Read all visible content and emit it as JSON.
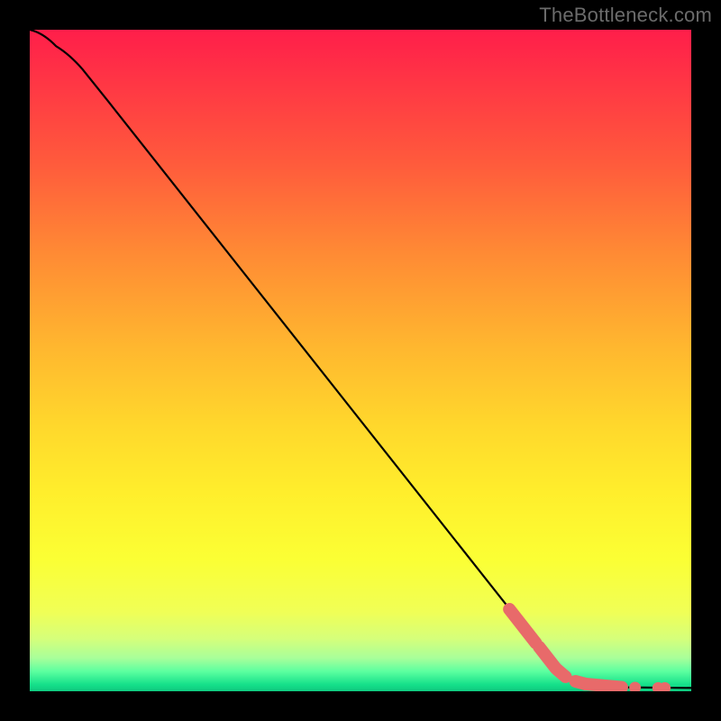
{
  "watermark": "TheBottleneck.com",
  "chart_data": {
    "type": "line",
    "title": "",
    "xlabel": "",
    "ylabel": "",
    "xlim": [
      0,
      100
    ],
    "ylim": [
      0,
      100
    ],
    "curve": [
      {
        "x": 0,
        "y": 100
      },
      {
        "x": 4,
        "y": 97.5
      },
      {
        "x": 8,
        "y": 94
      },
      {
        "x": 12,
        "y": 89
      },
      {
        "x": 80,
        "y": 3
      },
      {
        "x": 84,
        "y": 1.2
      },
      {
        "x": 90,
        "y": 0.6
      },
      {
        "x": 100,
        "y": 0.5
      }
    ],
    "highlight_runs": [
      {
        "xa": 72.5,
        "ya": 12.4,
        "xb": 76.5,
        "yb": 7.3
      },
      {
        "xa": 77.0,
        "ya": 6.7,
        "xb": 79.5,
        "yb": 3.5
      },
      {
        "xa": 79.7,
        "ya": 3.3,
        "xb": 81.0,
        "yb": 2.2
      },
      {
        "xa": 82.5,
        "ya": 1.5,
        "xb": 84.0,
        "yb": 1.1
      },
      {
        "xa": 84.0,
        "ya": 1.1,
        "xb": 89.5,
        "yb": 0.6
      }
    ],
    "highlight_dots": [
      {
        "x": 91.5,
        "y": 0.55
      },
      {
        "x": 95.0,
        "y": 0.5
      },
      {
        "x": 96.0,
        "y": 0.5
      }
    ],
    "colors": {
      "curve": "#000000",
      "highlight": "#e86a6a"
    }
  }
}
